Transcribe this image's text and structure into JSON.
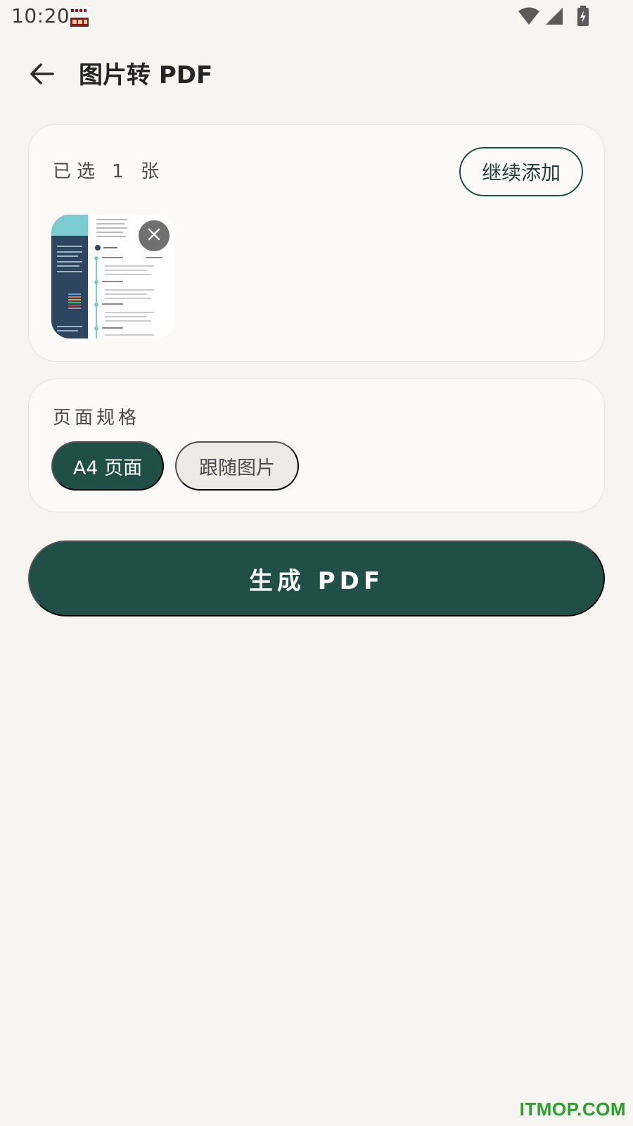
{
  "status_bar": {
    "time": "10:20",
    "icons": [
      "app-notification-icon",
      "wifi-icon",
      "cellular-signal-icon",
      "battery-charging-icon"
    ]
  },
  "app_bar": {
    "title": "图片转 PDF",
    "back_icon": "arrow-back-icon"
  },
  "images_card": {
    "selected_count": "已选 1 张",
    "add_more_label": "继续添加",
    "thumbnails": [
      {
        "remove_icon": "close-icon"
      }
    ]
  },
  "page_size_card": {
    "label": "页面规格",
    "options": [
      {
        "label": "A4 页面",
        "selected": true
      },
      {
        "label": "跟随图片",
        "selected": false
      }
    ]
  },
  "generate_button": {
    "label": "生成 PDF"
  },
  "watermark": "ITMOP.COM",
  "colors": {
    "accent": "#1f4f47",
    "background": "#f6f5f2",
    "card": "#fbfaf8",
    "chip_unselected": "#ecebe5"
  }
}
